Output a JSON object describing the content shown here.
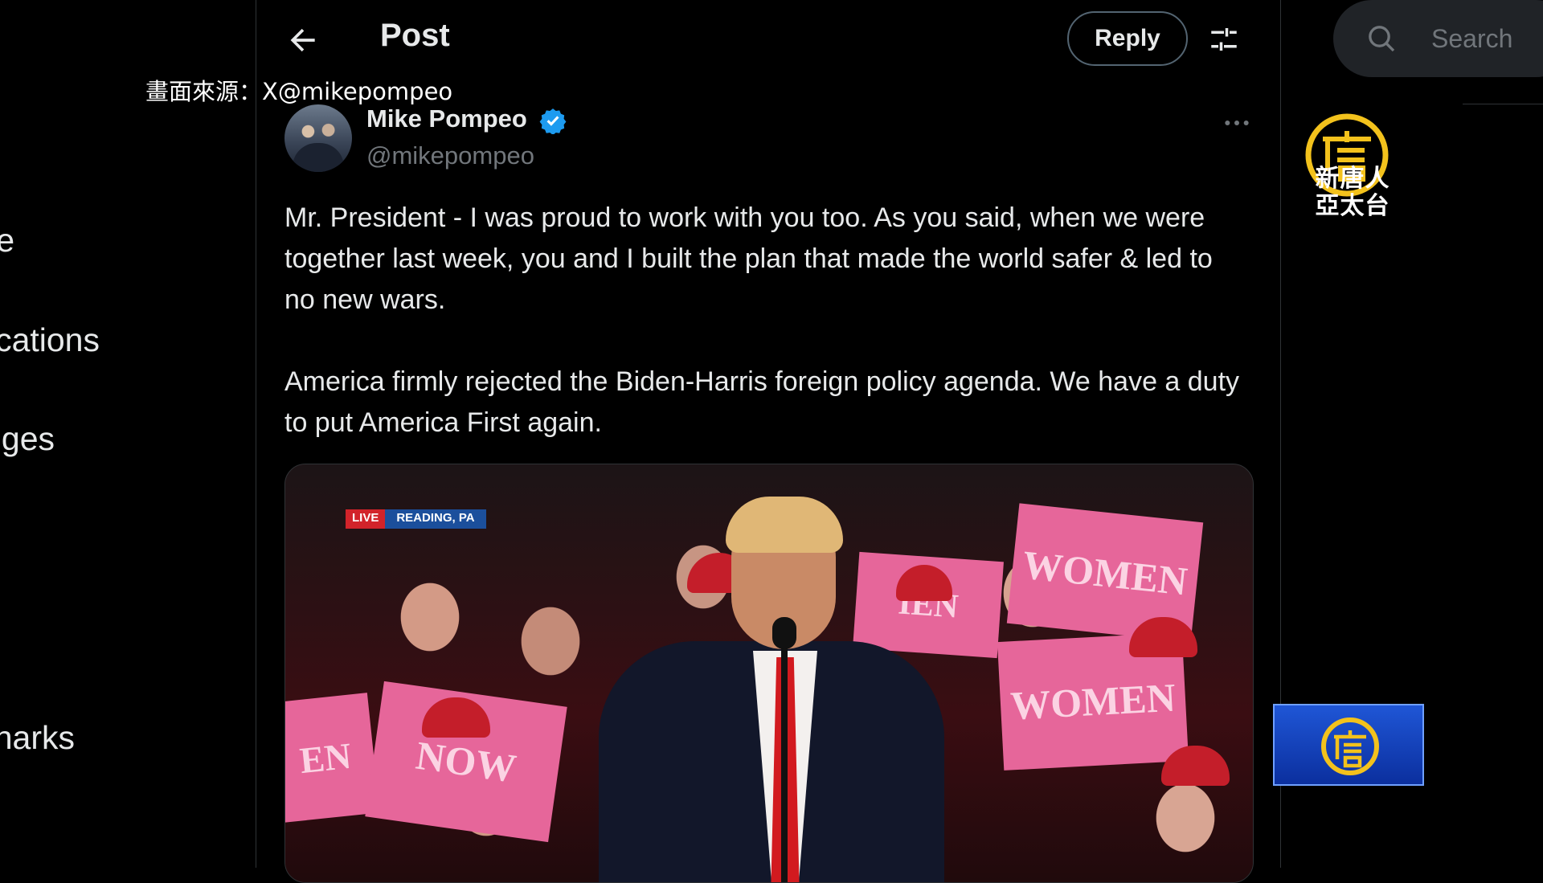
{
  "left_nav": {
    "items": [
      {
        "label": "e"
      },
      {
        "label": "cations"
      },
      {
        "label": "ges"
      },
      {
        "label": "narks"
      }
    ]
  },
  "header": {
    "title": "Post",
    "reply_label": "Reply"
  },
  "source_caption": "畫面來源：X@mikepompeo",
  "tweet": {
    "author_name": "Mike Pompeo",
    "author_handle": "@mikepompeo",
    "paragraphs": [
      "Mr. President - I was proud to work with you too. As you said, when we were together last week, you and I built the plan that made the world safer & led to no new wars.",
      "America firmly rejected the Biden-Harris foreign policy agenda. We have a duty to put America First again."
    ],
    "media": {
      "live_label": "LIVE",
      "location_label": "READING, PA",
      "sign_texts": [
        "WOMEN",
        "WOMEN",
        "IEN",
        "EN",
        "NOW"
      ]
    }
  },
  "search": {
    "placeholder": "Search"
  },
  "watermark": {
    "text_line1": "新唐人",
    "text_line2": "亞太台",
    "logo_glyph": "唐"
  },
  "colors": {
    "background": "#000000",
    "text_primary": "#e7e9ea",
    "text_secondary": "#71767b",
    "verified": "#1d9bf0",
    "logo_gold": "#f3c21c",
    "bug_blue": "#1f56d6"
  }
}
